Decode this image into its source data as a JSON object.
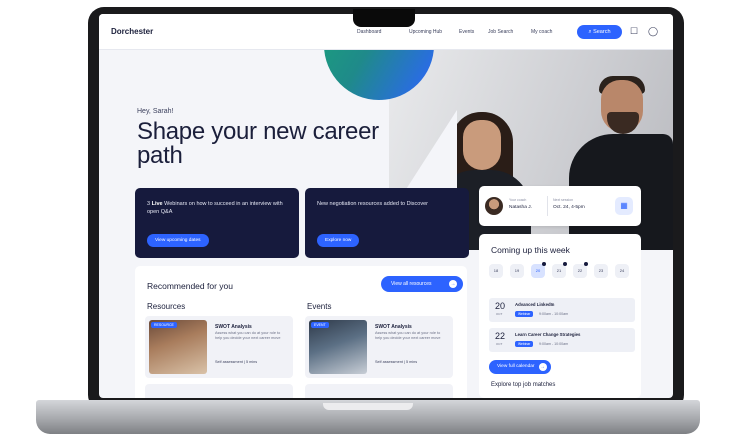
{
  "nav": {
    "brand": "Dorchester",
    "links": [
      "Dashboard",
      "Upcoming Hub",
      "Events",
      "Job Search",
      "My coach"
    ],
    "search_label": "Search"
  },
  "hero": {
    "greeting": "Hey, Sarah!",
    "headline": "Shape your new career path"
  },
  "promos": [
    {
      "prefix": "3 ",
      "emphasis": "Live",
      "rest": " Webinars on how to succeed in an interview with open Q&A",
      "button": "View upcoming dates"
    },
    {
      "text": "New negotiation resources added to Discover",
      "button": "Explore now"
    }
  ],
  "recommended": {
    "title": "Recommended for you",
    "view_all": "View all resources",
    "resources_heading": "Resources",
    "events_heading": "Events",
    "resource_tile": {
      "tag": "RESOURCE",
      "title": "SWOT Analysis",
      "description": "Assess what you can do at your role to help you decide your next career move",
      "meta": "Self assessment  |  5 mins"
    },
    "event_tile": {
      "tag": "EVENT",
      "title": "SWOT Analysis",
      "description": "Assess what you can do at your role to help you decide your next career move",
      "meta": "Self assessment  |  5 mins"
    }
  },
  "appointment": {
    "coach_label": "Your coach",
    "coach_name": "Natasha J.",
    "next_label": "Next session",
    "next_value": "Oct. 24, 4-5pm"
  },
  "week": {
    "title": "Coming up this week",
    "days": [
      "18",
      "19",
      "20",
      "21",
      "22",
      "23",
      "24"
    ],
    "events": [
      {
        "day": "20",
        "month": "OCT",
        "title": "Advanced LinkedIn",
        "tag": "Webinar",
        "time": "9:00am - 10:00am"
      },
      {
        "day": "22",
        "month": "OCT",
        "title": "Learn Career Change Strategies",
        "tag": "Webinar",
        "time": "9:00am - 10:00am"
      }
    ],
    "calendar_button": "View full calendar",
    "next_section": "Explore top job matches"
  },
  "colors": {
    "accent": "#2d63ff",
    "navy": "#161a3d",
    "background": "#f4f5f9"
  }
}
